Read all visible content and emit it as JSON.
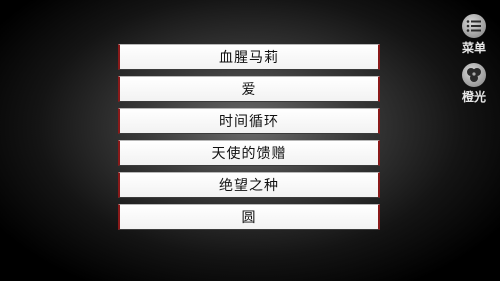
{
  "menu": {
    "items": [
      {
        "label": "血腥马莉"
      },
      {
        "label": "爱"
      },
      {
        "label": "时间循环"
      },
      {
        "label": "天使的馈赠"
      },
      {
        "label": "绝望之种"
      },
      {
        "label": "圆"
      }
    ]
  },
  "side_buttons": {
    "menu_label": "菜单",
    "menu_icon": "list-icon",
    "orange_label": "橙光",
    "orange_icon": "clover-icon"
  },
  "colors": {
    "item_border_accent": "#8a1a1a",
    "item_background": "#ffffff",
    "side_button_label": "#e6e6e6"
  }
}
